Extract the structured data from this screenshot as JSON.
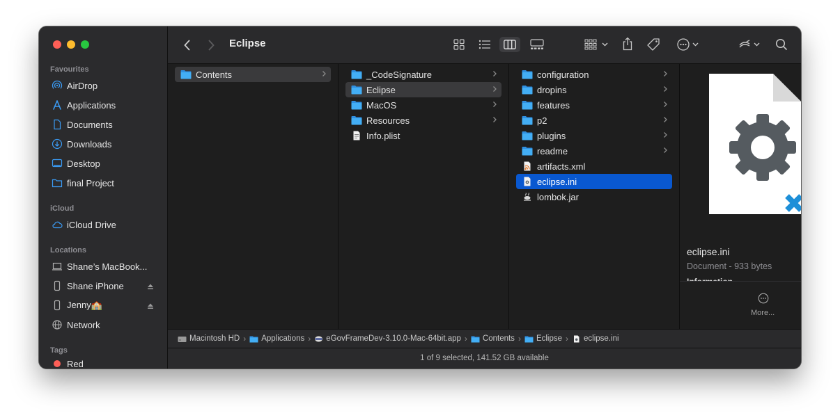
{
  "window": {
    "title": "Eclipse"
  },
  "sidebar": {
    "favourites_header": "Favourites",
    "favourites": [
      {
        "label": "AirDrop",
        "icon": "airdrop-icon"
      },
      {
        "label": "Applications",
        "icon": "applications-icon"
      },
      {
        "label": "Documents",
        "icon": "documents-icon"
      },
      {
        "label": "Downloads",
        "icon": "downloads-icon"
      },
      {
        "label": "Desktop",
        "icon": "desktop-icon"
      },
      {
        "label": "final Project",
        "icon": "folder-icon"
      }
    ],
    "icloud_header": "iCloud",
    "icloud": [
      {
        "label": "iCloud Drive",
        "icon": "cloud-icon"
      }
    ],
    "locations_header": "Locations",
    "locations": [
      {
        "label": "Shane’s MacBook...",
        "icon": "laptop-icon"
      },
      {
        "label": "Shane iPhone",
        "icon": "phone-icon"
      },
      {
        "label": "Jenny🏫",
        "icon": "phone-icon"
      },
      {
        "label": "Network",
        "icon": "network-icon"
      }
    ],
    "tags_header": "Tags",
    "tags": [
      {
        "label": "Red",
        "color": "#fe5f57"
      }
    ]
  },
  "columns": [
    {
      "items": [
        {
          "label": "Contents",
          "kind": "folder",
          "state": "selected-grey"
        }
      ]
    },
    {
      "items": [
        {
          "label": "_CodeSignature",
          "kind": "folder",
          "state": ""
        },
        {
          "label": "Eclipse",
          "kind": "folder",
          "state": "selected-grey"
        },
        {
          "label": "MacOS",
          "kind": "folder",
          "state": ""
        },
        {
          "label": "Resources",
          "kind": "folder",
          "state": ""
        },
        {
          "label": "Info.plist",
          "kind": "file",
          "state": ""
        }
      ]
    },
    {
      "items": [
        {
          "label": "configuration",
          "kind": "folder",
          "state": ""
        },
        {
          "label": "dropins",
          "kind": "folder",
          "state": ""
        },
        {
          "label": "features",
          "kind": "folder",
          "state": ""
        },
        {
          "label": "p2",
          "kind": "folder",
          "state": ""
        },
        {
          "label": "plugins",
          "kind": "folder",
          "state": ""
        },
        {
          "label": "readme",
          "kind": "folder",
          "state": ""
        },
        {
          "label": "artifacts.xml",
          "kind": "xml",
          "state": ""
        },
        {
          "label": "eclipse.ini",
          "kind": "ini",
          "state": "selected-blue"
        },
        {
          "label": "lombok.jar",
          "kind": "jar",
          "state": ""
        }
      ]
    }
  ],
  "preview": {
    "filename": "eclipse.ini",
    "kind_size": "Document - 933 bytes",
    "info_partial": "Information",
    "more_label": "More..."
  },
  "pathbar": [
    {
      "label": "Macintosh HD",
      "icon": "disk-icon"
    },
    {
      "label": "Applications",
      "icon": "folder-icon"
    },
    {
      "label": "eGovFrameDev-3.10.0-Mac-64bit.app",
      "icon": "app-icon"
    },
    {
      "label": "Contents",
      "icon": "folder-icon"
    },
    {
      "label": "Eclipse",
      "icon": "folder-icon"
    },
    {
      "label": "eclipse.ini",
      "icon": "ini-file-icon"
    }
  ],
  "status": "1 of 9 selected, 141.52 GB available",
  "colors": {
    "accent": "#0958d0",
    "folder": "#39a6f2",
    "background": "#1e1e1e"
  }
}
